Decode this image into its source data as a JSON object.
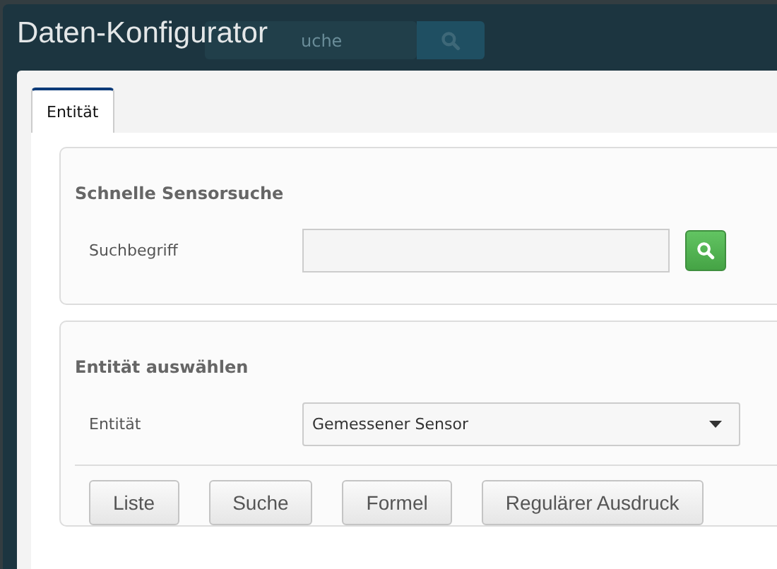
{
  "backdrop": {
    "search_text": "uche"
  },
  "window": {
    "title": "Daten-Konfigurator"
  },
  "tabs": [
    {
      "label": "Entität",
      "selected": true
    }
  ],
  "quick_search": {
    "title": "Schnelle Sensorsuche",
    "label": "Suchbegriff"
  },
  "entity_select": {
    "title": "Entität auswählen",
    "label": "Entität",
    "value": "Gemessener Sensor"
  },
  "buttons": [
    "Liste",
    "Suche",
    "Formel",
    "Regulärer Ausdruck"
  ]
}
